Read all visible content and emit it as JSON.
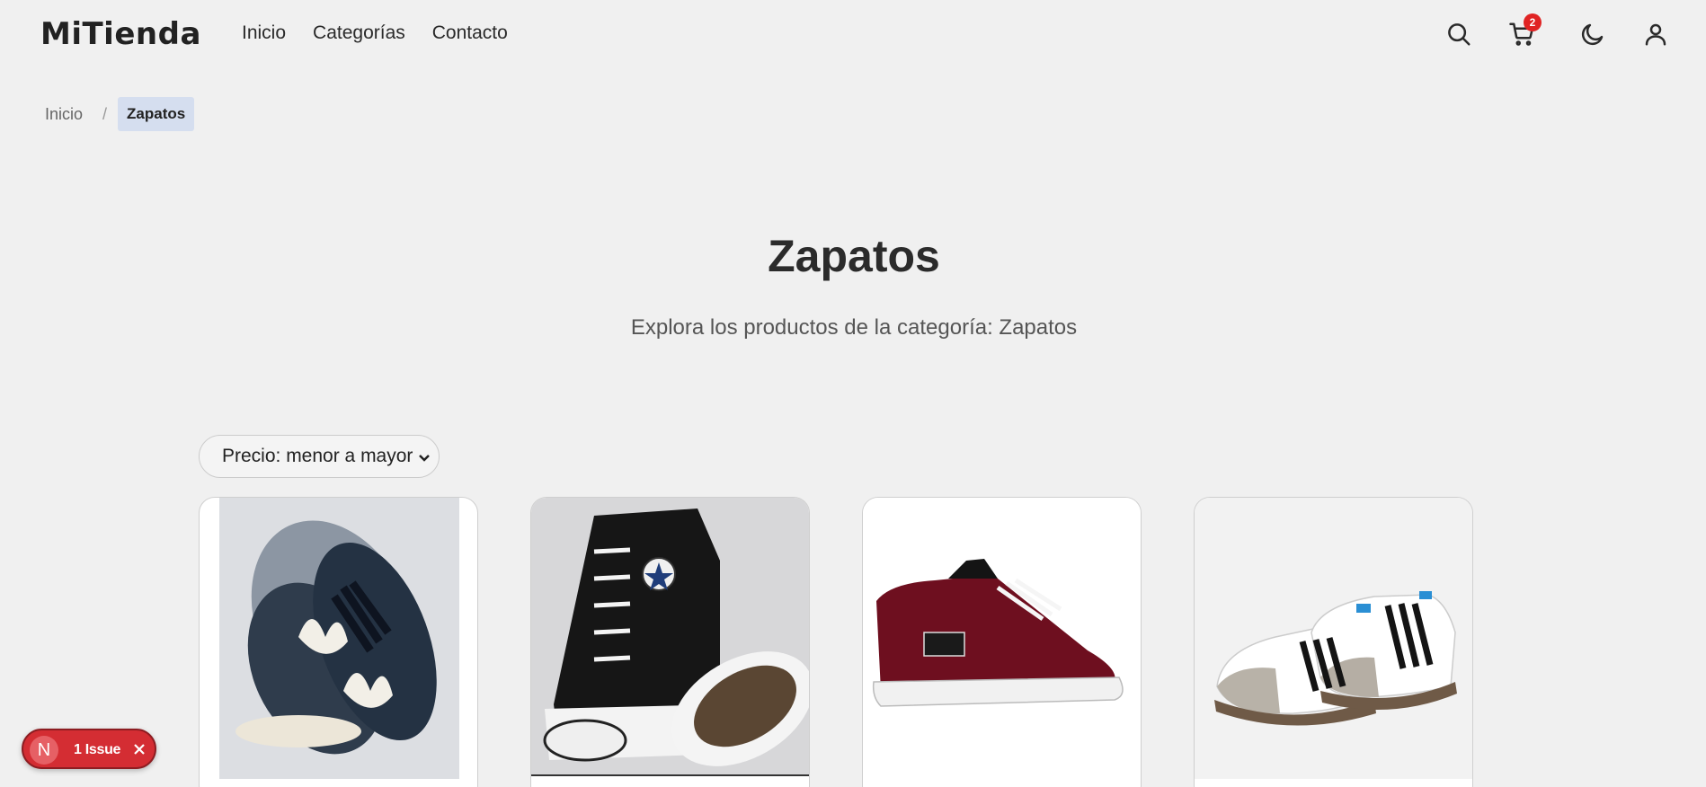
{
  "header": {
    "logo": "MiTienda",
    "nav": [
      "Inicio",
      "Categorías",
      "Contacto"
    ],
    "cart_count": "2",
    "icons": [
      "search-icon",
      "cart-icon",
      "moon-icon",
      "user-icon"
    ]
  },
  "breadcrumb": {
    "items": [
      "Inicio"
    ],
    "separator": "/",
    "current": "Zapatos"
  },
  "hero": {
    "title": "Zapatos",
    "subtitle": "Explora los productos de la categoría: Zapatos"
  },
  "sort": {
    "selected": "Precio: menor a mayor"
  },
  "products": [
    {
      "image": "navy adidas sneakers with white trefoil"
    },
    {
      "image": "black high-top canvas sneakers"
    },
    {
      "image": "burgundy suede skate shoe"
    },
    {
      "image": "white leather sneakers with black stripes"
    }
  ],
  "issue_badge": {
    "initial": "N",
    "label": "1 Issue"
  },
  "colors": {
    "background": "#f0f0f0",
    "badge": "#e02424",
    "breadcrumb_active": "#d5deef",
    "issue": "#d42d33"
  }
}
